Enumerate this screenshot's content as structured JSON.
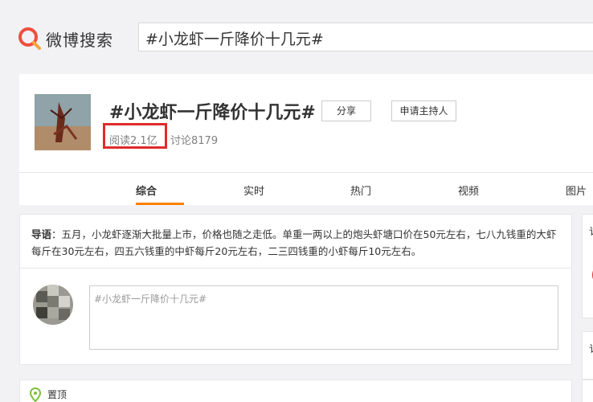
{
  "header": {
    "logo_text": "微博搜索",
    "search_value": "#小龙虾一斤降价十几元#"
  },
  "topic": {
    "title": "#小龙虾一斤降价十几元#",
    "share_label": "分享",
    "apply_host_label": "申请主持人",
    "read_label": "阅读2.1亿",
    "discuss_label": "讨论8179"
  },
  "tabs": [
    {
      "label": "综合"
    },
    {
      "label": "实时"
    },
    {
      "label": "热门"
    },
    {
      "label": "视频"
    },
    {
      "label": "图片"
    }
  ],
  "intro": {
    "prefix": "导语",
    "text": "：五月，小龙虾逐渐大批量上市，价格也随之走低。单重一两以上的炮头虾塘口价在50元左右，七八九钱重的大虾每斤在30元左右，四五六钱重的中虾每斤20元左右，二三四钱重的小虾每斤10元左右。"
  },
  "compose": {
    "placeholder": "#小龙虾一斤降价十几元#"
  },
  "pinned": {
    "label": "置顶"
  },
  "side": {
    "char1": "讠",
    "char2": "讠"
  },
  "colors": {
    "accent": "#ff8200",
    "highlight": "#e02b2b"
  }
}
